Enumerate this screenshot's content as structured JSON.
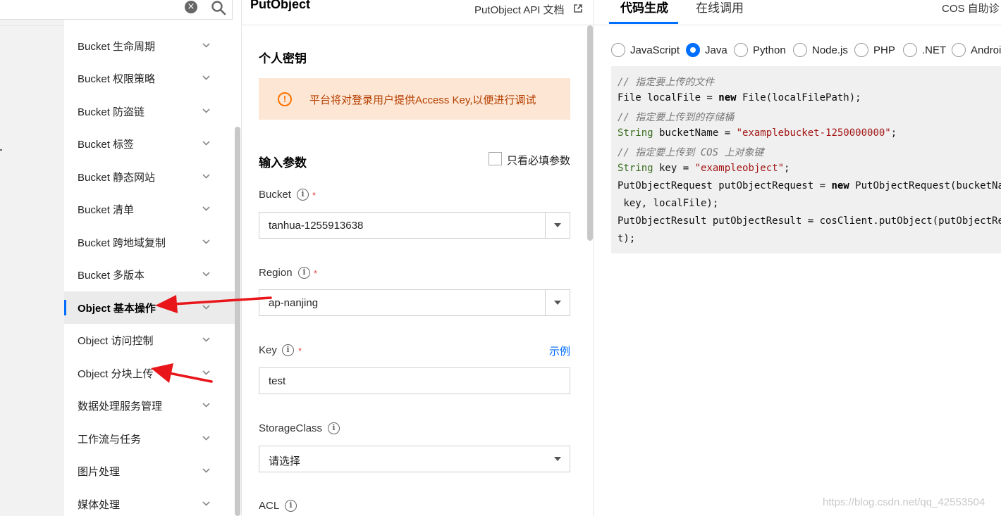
{
  "search": {
    "clear_icon": "close-circle-icon",
    "search_icon": "search-icon"
  },
  "sidebar": {
    "items": [
      {
        "label": "Bucket 生命周期"
      },
      {
        "label": "Bucket 权限策略"
      },
      {
        "label": "Bucket 防盗链"
      },
      {
        "label": "Bucket 标签"
      },
      {
        "label": "Bucket 静态网站"
      },
      {
        "label": "Bucket 清单"
      },
      {
        "label": "Bucket 跨地域复制"
      },
      {
        "label": "Bucket 多版本"
      },
      {
        "label": "Object 基本操作",
        "active": true
      },
      {
        "label": "Object 访问控制"
      },
      {
        "label": "Object 分块上传"
      },
      {
        "label": "数据处理服务管理"
      },
      {
        "label": "工作流与任务"
      },
      {
        "label": "图片处理"
      },
      {
        "label": "媒体处理"
      }
    ]
  },
  "middle": {
    "title": "PutObject",
    "api_doc_label": "PutObject API 文档",
    "secret_section_title": "个人密钥",
    "alert_text": "平台将对登录用户提供Access Key,以便进行调试",
    "params_title": "输入参数",
    "required_only_label": "只看必填参数",
    "fields": {
      "bucket": {
        "label": "Bucket",
        "value": "tanhua-1255913638"
      },
      "region": {
        "label": "Region",
        "value": "ap-nanjing"
      },
      "key": {
        "label": "Key",
        "value": "test",
        "example_link": "示例"
      },
      "storage_class": {
        "label": "StorageClass",
        "value": "请选择"
      },
      "acl": {
        "label": "ACL"
      }
    },
    "required_mark": "*"
  },
  "right": {
    "tabs": [
      {
        "label": "代码生成",
        "active": true
      },
      {
        "label": "在线调用"
      }
    ],
    "cos_diag_label": "COS 自助诊",
    "languages": [
      {
        "label": "JavaScript",
        "checked": false
      },
      {
        "label": "Java",
        "checked": true
      },
      {
        "label": "Python",
        "checked": false
      },
      {
        "label": "Node.js",
        "checked": false
      },
      {
        "label": "PHP",
        "checked": false
      },
      {
        "label": ".NET",
        "checked": false
      },
      {
        "label": "Androi",
        "checked": false
      }
    ],
    "code": {
      "l1": "// 指定要上传的文件",
      "l2_a": "File localFile = ",
      "l2_kw": "new",
      "l2_b": " File(localFilePath);",
      "l3": "// 指定要上传到的存储桶",
      "l4_ty": "String",
      "l4_a": " bucketName = ",
      "l4_st": "\"examplebucket-1250000000\"",
      "l4_b": ";",
      "l5": "// 指定要上传到 COS 上对象键",
      "l6_ty": "String",
      "l6_a": " key = ",
      "l6_st": "\"exampleobject\"",
      "l6_b": ";",
      "l7_a": "PutObjectRequest putObjectRequest = ",
      "l7_kw": "new",
      "l7_b": " PutObjectRequest(bucketName,",
      "l8": " key, localFile);",
      "l9": "PutObjectResult putObjectResult = cosClient.putObject(putObjectRequ",
      "l10": "t);"
    }
  },
  "watermark": "https://blog.csdn.net/qq_42553504",
  "colors": {
    "accent": "#006eff",
    "alert_bg": "#fde6d3",
    "alert_text": "#b43f00",
    "annotation_red": "#e8161b"
  }
}
